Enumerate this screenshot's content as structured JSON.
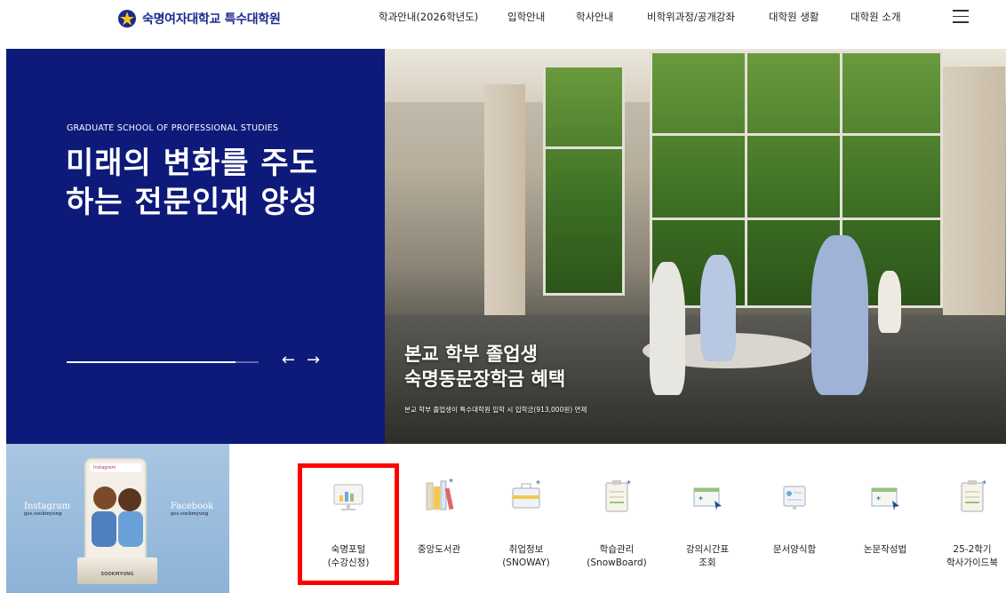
{
  "header": {
    "logo_text": "숙명여자대학교 특수대학원",
    "nav": [
      {
        "label": "학과안내(2026학년도)"
      },
      {
        "label": "입학안내"
      },
      {
        "label": "학사안내"
      },
      {
        "label": "비학위과정/공개강좌"
      },
      {
        "label": "대학원 생활"
      },
      {
        "label": "대학원 소개"
      }
    ],
    "menu_icon": "hamburger-icon"
  },
  "hero": {
    "eyebrow": "GRADUATE SCHOOL OF PROFESSIONAL STUDIES",
    "title_line1": "미래의 변화를 주도",
    "title_line2": "하는 전문인재 양성",
    "slider_progress": 0.88,
    "prev_arrow": "←",
    "next_arrow": "→",
    "caption_line1": "본교 학부 졸업생",
    "caption_line2": "숙명동문장학금 혜택",
    "caption_sub": "본교 학부 졸업생이 특수대학원 입학 시 입학금(913,000원) 면제"
  },
  "sns": {
    "instagram_label": "Instagram",
    "instagram_handle": "gss.sookmyung",
    "facebook_label": "Facebook",
    "facebook_handle": "gss.sookmyung",
    "phone_label": "Instagram",
    "pedestal_label": "SOOKMYUNG"
  },
  "quick_links": [
    {
      "label": "숙명포털\n(수강신청)",
      "icon": "monitor-chart-icon",
      "highlighted": true
    },
    {
      "label": "중앙도서관",
      "icon": "books-icon"
    },
    {
      "label": "취업정보\n(SNOWAY)",
      "icon": "briefcase-icon"
    },
    {
      "label": "학습관리\n(SnowBoard)",
      "icon": "clipboard-icon"
    },
    {
      "label": "강의시간표\n조회",
      "icon": "timetable-icon"
    },
    {
      "label": "문서양식함",
      "icon": "document-form-icon"
    },
    {
      "label": "논문작성법",
      "icon": "thesis-guide-icon"
    },
    {
      "label": "25-2학기\n학사가이드북",
      "icon": "guidebook-icon"
    }
  ],
  "colors": {
    "brand_navy": "#0e1a7a",
    "highlight_red": "#ff0000"
  }
}
